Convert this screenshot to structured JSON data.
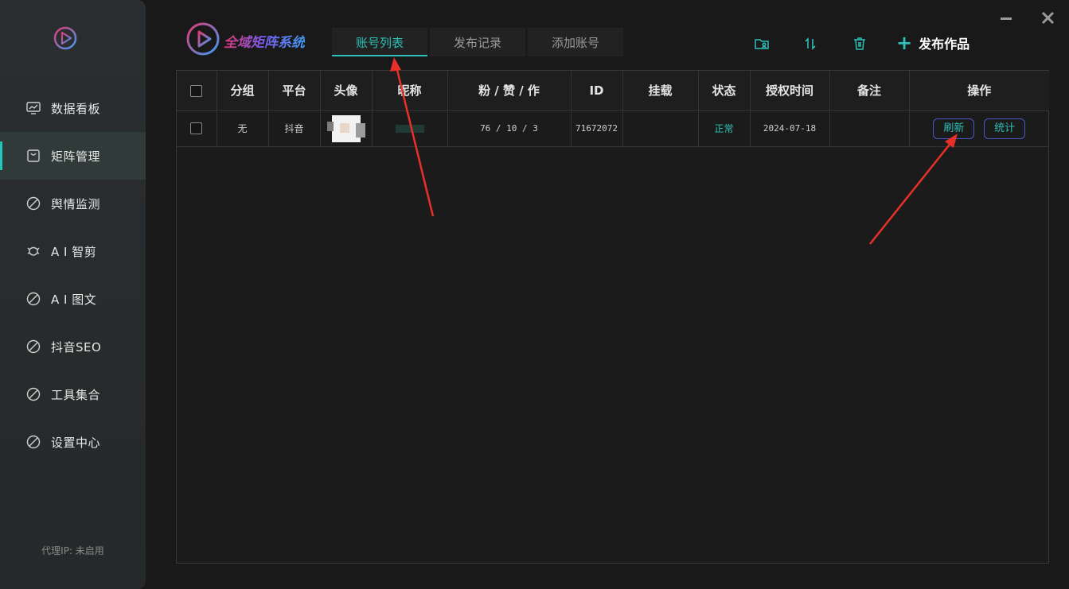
{
  "sidebar": {
    "items": [
      {
        "label": "数据看板",
        "icon": "monitor-chart-icon"
      },
      {
        "label": "矩阵管理",
        "icon": "shopping-bag-icon",
        "active": true
      },
      {
        "label": "舆情监测",
        "icon": "prohibited-icon"
      },
      {
        "label": "A I 智剪",
        "icon": "bug-icon"
      },
      {
        "label": "A I 图文",
        "icon": "prohibited-icon"
      },
      {
        "label": "抖音SEO",
        "icon": "prohibited-icon"
      },
      {
        "label": "工具集合",
        "icon": "prohibited-icon"
      },
      {
        "label": "设置中心",
        "icon": "prohibited-icon"
      }
    ],
    "proxy": "代理IP: 未启用"
  },
  "header": {
    "brand": "全域矩阵系统",
    "tabs": [
      {
        "label": "账号列表",
        "active": true
      },
      {
        "label": "发布记录"
      },
      {
        "label": "添加账号"
      }
    ],
    "publish_label": "发布作品"
  },
  "table": {
    "columns": [
      "",
      "分组",
      "平台",
      "头像",
      "昵称",
      "粉 / 赞 / 作",
      "ID",
      "挂载",
      "状态",
      "授权时间",
      "备注",
      "操作"
    ],
    "rows": [
      {
        "group": "无",
        "platform": "抖音",
        "stats": "76 / 10 / 3",
        "id": "71672072",
        "mount": "",
        "status": "正常",
        "auth_time": "2024-07-18",
        "note": "",
        "actions": [
          "刷新",
          "统计"
        ]
      }
    ]
  },
  "colors": {
    "accent": "#2cc0b6",
    "button_border": "#4b56c8",
    "annotation_arrow": "#e8302a"
  }
}
